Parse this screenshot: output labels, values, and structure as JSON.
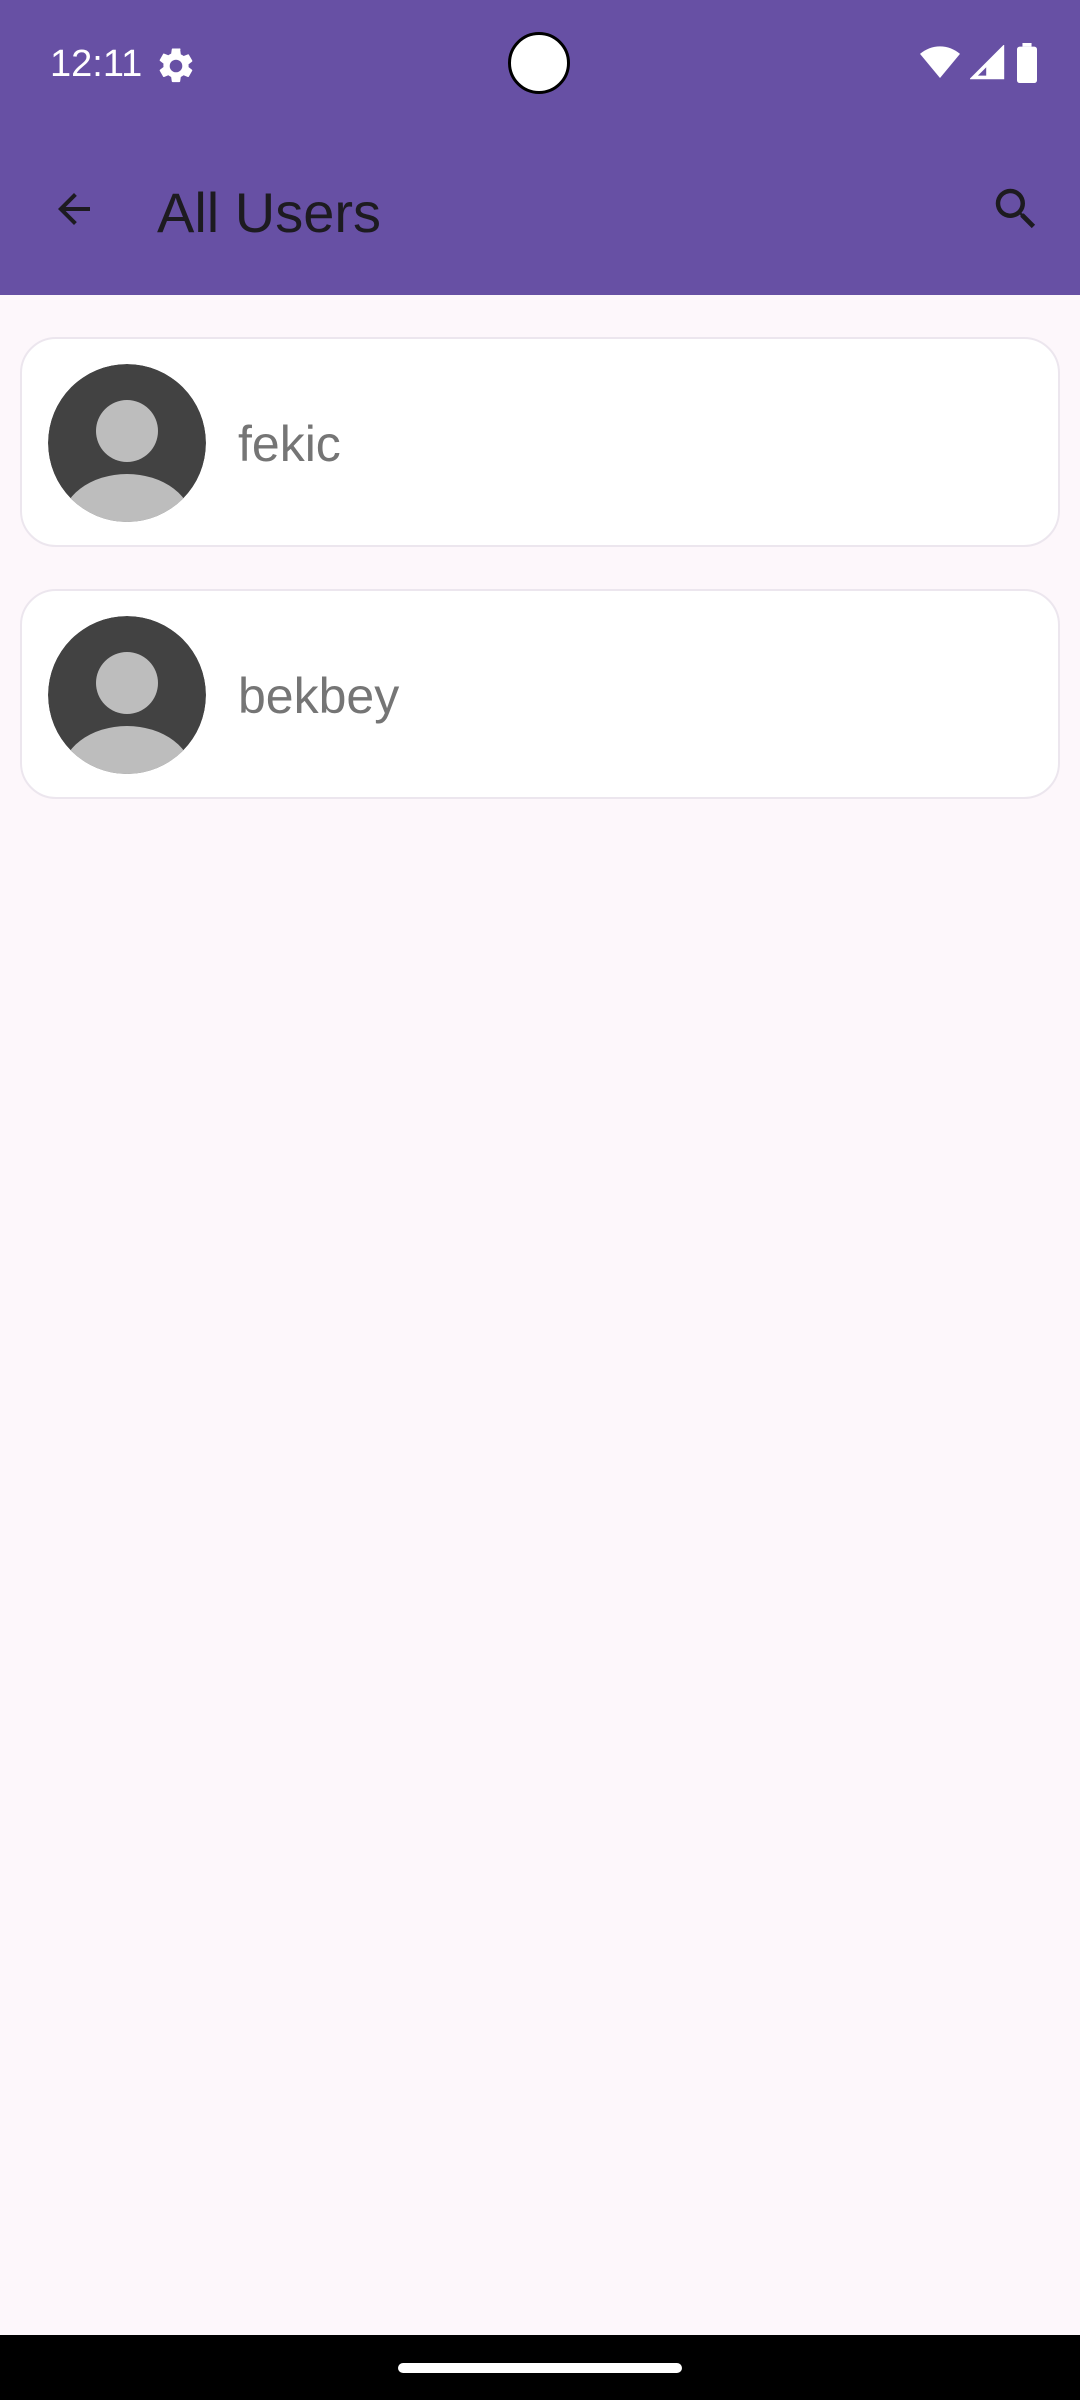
{
  "status_bar": {
    "time": "12:11",
    "icons": [
      "settings-icon",
      "wifi-icon",
      "signal-icon",
      "battery-icon"
    ]
  },
  "app_bar": {
    "title": "All Users",
    "back_icon": "arrow-back-icon",
    "search_icon": "search-icon"
  },
  "users": [
    {
      "name": "fekic",
      "avatar": "default-avatar"
    },
    {
      "name": "bekbey",
      "avatar": "default-avatar"
    }
  ],
  "colors": {
    "primary": "#6750A4",
    "background": "#FDF7FB",
    "card": "#FFFFFF",
    "name_text": "#757575",
    "avatar_dark": "#424242",
    "avatar_light": "#BDBDBD"
  }
}
